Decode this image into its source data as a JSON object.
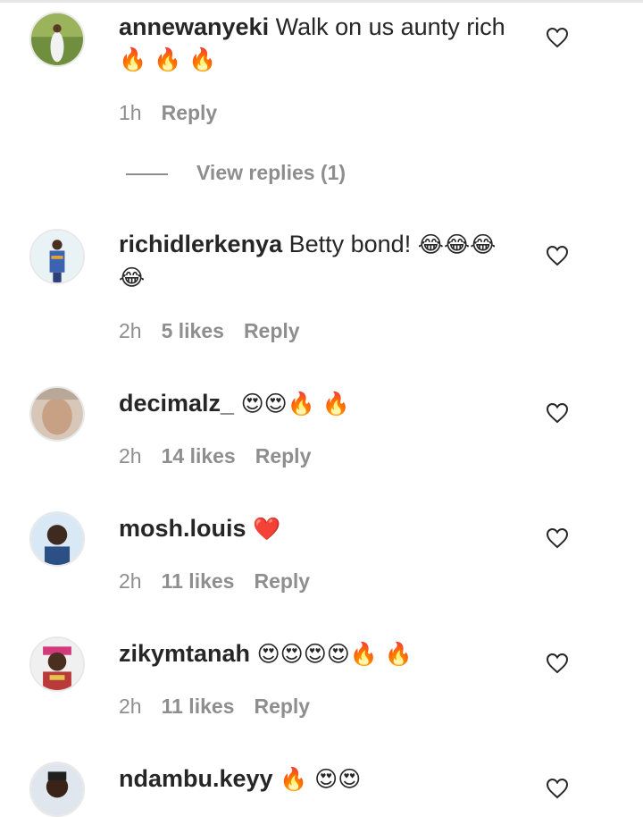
{
  "comments": [
    {
      "username": "annewanyeki",
      "text": "Walk on us aunty rich",
      "emoji": "🔥 🔥 🔥",
      "time": "1h",
      "likes": "",
      "reply": "Reply"
    },
    {
      "username": "richidlerkenya",
      "text": "Betty bond!",
      "emoji": "😂😂😂 😂",
      "time": "2h",
      "likes": "5 likes",
      "reply": "Reply"
    },
    {
      "username": "decimalz_",
      "text": "",
      "emoji": "😍😍🔥 🔥",
      "time": "2h",
      "likes": "14 likes",
      "reply": "Reply"
    },
    {
      "username": "mosh.louis",
      "text": "",
      "emoji": "❤️",
      "time": "2h",
      "likes": "11 likes",
      "reply": "Reply"
    },
    {
      "username": "zikymtanah",
      "text": "",
      "emoji": "😍😍😍😍🔥 🔥",
      "time": "2h",
      "likes": "11 likes",
      "reply": "Reply"
    },
    {
      "username": "ndambu.keyy",
      "text": "",
      "emoji": "🔥 😍😍",
      "time": "",
      "likes": "",
      "reply": ""
    }
  ],
  "view_replies": "View replies (1)",
  "icons": {
    "like": "heart-outline-icon",
    "avatar": "profile-photo"
  },
  "colors": {
    "text": "#262626",
    "secondary": "#8e8e8e"
  }
}
